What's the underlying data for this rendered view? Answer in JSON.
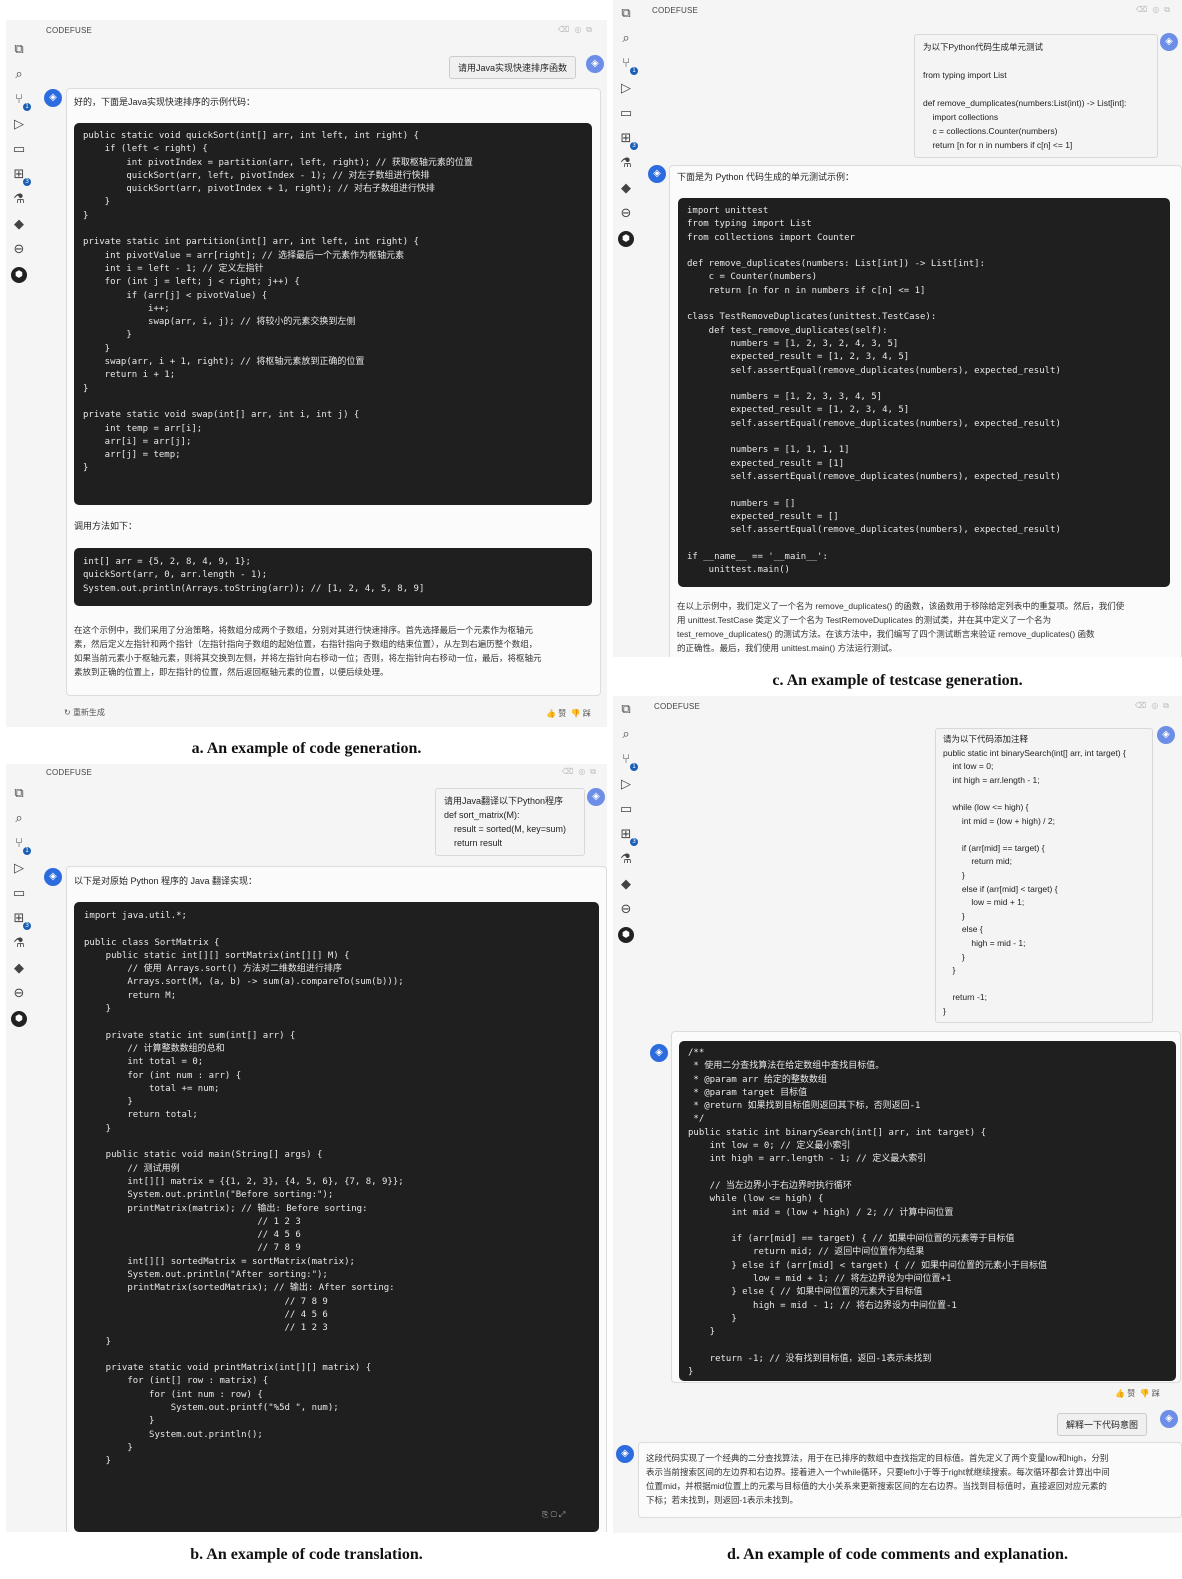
{
  "app_name": "CODEFUSE",
  "header_icons": [
    "delete-icon",
    "help-icon",
    "external-link-icon"
  ],
  "rail_icons": [
    "copy-icon",
    "search-icon",
    "source-control-icon",
    "run-debug-icon",
    "remote-explorer-icon",
    "extensions-icon",
    "testing-icon",
    "docker-icon",
    "terminal-icon",
    "codefuse-logo"
  ],
  "rail_badge": "1",
  "rail_badge2": "3",
  "captions": {
    "a": "a. An example of code generation.",
    "b": "b. An example of code translation.",
    "c": "c. An example of testcase generation.",
    "d": "d. An example of code comments and explanation."
  },
  "panel_a": {
    "user_msg": "请用Java实现快速排序函数",
    "intro": "好的，下面是Java实现快速排序的示例代码：",
    "code": [
      "public static void quickSort(int[] arr, int left, int right) {",
      "    if (left < right) {",
      "        int pivotIndex = partition(arr, left, right); // 获取枢轴元素的位置",
      "        quickSort(arr, left, pivotIndex - 1); // 对左子数组进行快排",
      "        quickSort(arr, pivotIndex + 1, right); // 对右子数组进行快排",
      "    }",
      "}",
      "",
      "private static int partition(int[] arr, int left, int right) {",
      "    int pivotValue = arr[right]; // 选择最后一个元素作为枢轴元素",
      "    int i = left - 1; // 定义左指针",
      "    for (int j = left; j < right; j++) {",
      "        if (arr[j] < pivotValue) {",
      "            i++;",
      "            swap(arr, i, j); // 将较小的元素交换到左侧",
      "        }",
      "    }",
      "    swap(arr, i + 1, right); // 将枢轴元素放到正确的位置",
      "    return i + 1;",
      "}",
      "",
      "private static void swap(int[] arr, int i, int j) {",
      "    int temp = arr[i];",
      "    arr[i] = arr[j];",
      "    arr[j] = temp;",
      "}"
    ],
    "call_label": "调用方法如下：",
    "code2": [
      "int[] arr = {5, 2, 8, 4, 9, 1};",
      "quickSort(arr, 0, arr.length - 1);",
      "System.out.println(Arrays.toString(arr)); // [1, 2, 4, 5, 8, 9]"
    ],
    "explain": [
      "在这个示例中，我们采用了分治策略，将数组分成两个子数组，分别对其进行快速排序。首先选择最后一个元素作为枢轴元",
      "素，然后定义左指针和两个指针（左指针指向子数组的起始位置，右指针指向子数组的结束位置），从左到右遍历整个数组，",
      "如果当前元素小于枢轴元素，则将其交换到左侧，并将左指针向右移动一位；否则，将左指针向右移动一位，最后，将枢轴元",
      "素放到正确的位置上，即左指针的位置，然后返回枢轴元素的位置，以便后续处理。"
    ],
    "regen": "重新生成",
    "like": "赞",
    "dislike": "踩"
  },
  "panel_b": {
    "user_msg": [
      "请用Java翻译以下Python程序",
      "def sort_matrix(M):",
      "    result = sorted(M, key=sum)",
      "    return result"
    ],
    "intro": "以下是对原始 Python 程序的 Java 翻译实现：",
    "code": [
      "import java.util.*;",
      "",
      "public class SortMatrix {",
      "    public static int[][] sortMatrix(int[][] M) {",
      "        // 使用 Arrays.sort() 方法对二维数组进行排序",
      "        Arrays.sort(M, (a, b) -> sum(a).compareTo(sum(b)));",
      "        return M;",
      "    }",
      "",
      "    private static int sum(int[] arr) {",
      "        // 计算整数数组的总和",
      "        int total = 0;",
      "        for (int num : arr) {",
      "            total += num;",
      "        }",
      "        return total;",
      "    }",
      "",
      "    public static void main(String[] args) {",
      "        // 测试用例",
      "        int[][] matrix = {{1, 2, 3}, {4, 5, 6}, {7, 8, 9}};",
      "        System.out.println(\"Before sorting:\");",
      "        printMatrix(matrix); // 输出: Before sorting:",
      "                                // 1 2 3",
      "                                // 4 5 6",
      "                                // 7 8 9",
      "        int[][] sortedMatrix = sortMatrix(matrix);",
      "        System.out.println(\"After sorting:\");",
      "        printMatrix(sortedMatrix); // 输出: After sorting:",
      "                                     // 7 8 9",
      "                                     // 4 5 6",
      "                                     // 1 2 3",
      "    }",
      "",
      "    private static void printMatrix(int[][] matrix) {",
      "        for (int[] row : matrix) {",
      "            for (int num : row) {",
      "                System.out.printf(\"%5d \", num);",
      "            }",
      "            System.out.println();",
      "        }",
      "    }"
    ]
  },
  "panel_c": {
    "user_msg": [
      "为以下Python代码生成单元测试",
      "",
      "from typing import List",
      "",
      "def remove_dumplicates(numbers:List(int)) -> List[int]:",
      "    import collections",
      "    c = collections.Counter(numbers)",
      "    return [n for n in numbers if c[n] <= 1]"
    ],
    "intro": "下面是为 Python 代码生成的单元测试示例：",
    "code": [
      "import unittest",
      "from typing import List",
      "from collections import Counter",
      "",
      "def remove_duplicates(numbers: List[int]) -> List[int]:",
      "    c = Counter(numbers)",
      "    return [n for n in numbers if c[n] <= 1]",
      "",
      "class TestRemoveDuplicates(unittest.TestCase):",
      "    def test_remove_duplicates(self):",
      "        numbers = [1, 2, 3, 2, 4, 3, 5]",
      "        expected_result = [1, 2, 3, 4, 5]",
      "        self.assertEqual(remove_duplicates(numbers), expected_result)",
      "",
      "        numbers = [1, 2, 3, 3, 4, 5]",
      "        expected_result = [1, 2, 3, 4, 5]",
      "        self.assertEqual(remove_duplicates(numbers), expected_result)",
      "",
      "        numbers = [1, 1, 1, 1]",
      "        expected_result = [1]",
      "        self.assertEqual(remove_duplicates(numbers), expected_result)",
      "",
      "        numbers = []",
      "        expected_result = []",
      "        self.assertEqual(remove_duplicates(numbers), expected_result)",
      "",
      "if __name__ == '__main__':",
      "    unittest.main()"
    ],
    "explain": [
      "在以上示例中，我们定义了一个名为 remove_duplicates() 的函数，该函数用于移除给定列表中的重复项。然后，我们使",
      "用 unittest.TestCase 类定义了一个名为 TestRemoveDuplicates 的测试类，并在其中定义了一个名为",
      "test_remove_duplicates() 的测试方法。在该方法中，我们编写了四个测试断言来验证 remove_duplicates() 函数",
      "的正确性。最后，我们使用 unittest.main() 方法运行测试。"
    ]
  },
  "panel_d": {
    "user_msg": [
      "请为以下代码添加注释",
      "public static int binarySearch(int[] arr, int target) {",
      "    int low = 0;",
      "    int high = arr.length - 1;",
      "",
      "    while (low <= high) {",
      "        int mid = (low + high) / 2;",
      "",
      "        if (arr[mid] == target) {",
      "            return mid;",
      "        }",
      "        else if (arr[mid] < target) {",
      "            low = mid + 1;",
      "        }",
      "        else {",
      "            high = mid - 1;",
      "        }",
      "    }",
      "",
      "    return -1;",
      "}"
    ],
    "code": [
      "/**",
      " * 使用二分查找算法在给定数组中查找目标值。",
      " * @param arr 给定的整数数组",
      " * @param target 目标值",
      " * @return 如果找到目标值则返回其下标，否则返回-1",
      " */",
      "public static int binarySearch(int[] arr, int target) {",
      "    int low = 0; // 定义最小索引",
      "    int high = arr.length - 1; // 定义最大索引",
      "",
      "    // 当左边界小于右边界时执行循环",
      "    while (low <= high) {",
      "        int mid = (low + high) / 2; // 计算中间位置",
      "",
      "        if (arr[mid] == target) { // 如果中间位置的元素等于目标值",
      "            return mid; // 返回中间位置作为结果",
      "        } else if (arr[mid] < target) { // 如果中间位置的元素小于目标值",
      "            low = mid + 1; // 将左边界设为中间位置+1",
      "        } else { // 如果中间位置的元素大于目标值",
      "            high = mid - 1; // 将右边界设为中间位置-1",
      "        }",
      "    }",
      "",
      "    return -1; // 没有找到目标值，返回-1表示未找到",
      "}"
    ],
    "like": "赞",
    "dislike": "踩",
    "followup": "解释一下代码意图",
    "explain": [
      "这段代码实现了一个经典的二分查找算法，用于在已排序的数组中查找指定的目标值。首先定义了两个变量low和high，分别",
      "表示当前搜索区间的左边界和右边界。接着进入一个while循环，只要left小于等于right就继续搜索。每次循环都会计算出中间",
      "位置mid，并根据mid位置上的元素与目标值的大小关系来更新搜索区间的左右边界。当找到目标值时，直接返回对应元素的",
      "下标；若未找到，则返回-1表示未找到。"
    ]
  }
}
